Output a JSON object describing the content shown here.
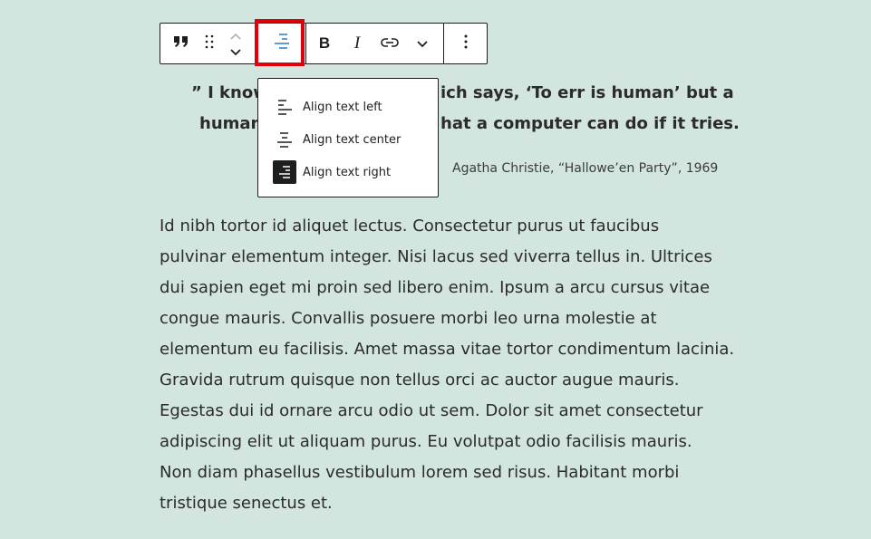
{
  "toolbar": {
    "buttons": [
      {
        "name": "quote-icon"
      },
      {
        "name": "drag-handle-icon"
      },
      {
        "name": "move-up-icon"
      },
      {
        "name": "move-down-icon"
      },
      {
        "name": "align-center-icon"
      },
      {
        "name": "bold",
        "label": "B"
      },
      {
        "name": "italic",
        "label": "I"
      },
      {
        "name": "link-icon"
      },
      {
        "name": "more-rich-text-icon"
      },
      {
        "name": "options-icon"
      }
    ],
    "active_color": "#3582c4"
  },
  "quote": {
    "line1_left": "” I know",
    "line1_right": "ich says, ‘To err is human’ but a",
    "line2_left": "human",
    "line2_right": "hat a computer can do if it tries.",
    "citation": "Agatha Christie, “Hallowe’en Party”, 1969"
  },
  "align_menu": {
    "items": [
      {
        "label": "Align text left",
        "icon": "align-left-icon",
        "active": false
      },
      {
        "label": "Align text center",
        "icon": "align-center-icon",
        "active": false
      },
      {
        "label": "Align text right",
        "icon": "align-right-icon",
        "active": true
      }
    ]
  },
  "paragraph": {
    "lines": [
      "Id nibh tortor id aliquet lectus. Consectetur purus ut faucibus",
      "pulvinar elementum integer. Nisi lacus sed viverra tellus in. Ultrices",
      "dui sapien eget mi proin sed libero enim. Ipsum a arcu cursus vitae",
      "congue mauris. Convallis posuere morbi leo urna molestie at",
      "elementum eu facilisis. Amet massa vitae tortor condimentum lacinia.",
      "Gravida rutrum quisque non tellus orci ac auctor augue mauris.",
      "Egestas dui id ornare arcu odio ut sem. Dolor sit amet consectetur",
      "adipiscing elit ut aliquam purus. Eu volutpat odio facilisis mauris.",
      "Non diam phasellus vestibulum lorem sed risus. Habitant morbi",
      "tristique senectus et."
    ]
  },
  "colors": {
    "background": "#d2e5de",
    "highlight": "#e0000b"
  }
}
